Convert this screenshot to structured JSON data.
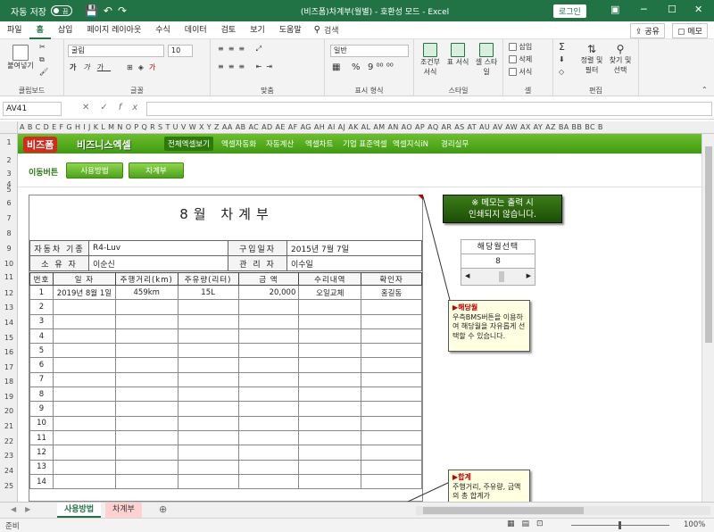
{
  "titlebar": {
    "autosave_label": "자동 저장",
    "autosave_state": "끔",
    "window_title": "(비즈폼)차계부(월별) - 호환성 모드 - Excel",
    "login_label": "로그인"
  },
  "menu": {
    "tabs": [
      "파일",
      "홈",
      "삽입",
      "페이지 레이아웃",
      "수식",
      "데이터",
      "검토",
      "보기",
      "도움말"
    ],
    "active_tab": "홈",
    "search_label": "검색",
    "share_label": "공유",
    "memo_label": "메모"
  },
  "ribbon": {
    "paste_label": "붙여넣기",
    "font_name": "굴림",
    "font_size": "10",
    "number_format": "일반",
    "percent_symbol": "%",
    "conditional_label": "조건부 서식",
    "table_label": "표 서식",
    "cellstyle_label": "셀 스타일",
    "insert_label": "삽입",
    "delete_label": "삭제",
    "format_label": "서식",
    "sort_label": "정렬 및 필터",
    "find_label": "찾기 및 선택",
    "groups": [
      "클립보드",
      "글꼴",
      "맞춤",
      "표시 형식",
      "스타일",
      "셀",
      "편집"
    ]
  },
  "formula_bar": {
    "name_box": "AV41",
    "fx": "fx",
    "content": ""
  },
  "column_letters": "A B C D E F G H I J K L M N O P Q R S T U V W X Y Z AA AB AC AD AE AF AG AH AI AJ AK AL AM AN AO AP AQ AR AS AT AU AV AW AX AY AZ BA BB BC B",
  "row_numbers": [
    "1",
    "2",
    "3",
    "4",
    "5",
    "6",
    "7",
    "8",
    "9",
    "10",
    "11",
    "12",
    "13",
    "14",
    "15",
    "16",
    "17",
    "18",
    "19",
    "20",
    "21",
    "22",
    "23",
    "24",
    "25"
  ],
  "navbar": {
    "brand": "비즈폼",
    "brand2": "비즈니스엑셀",
    "items": [
      "전체엑셀보기",
      "엑셀자동화",
      "자동계산",
      "엑셀차트",
      "기업 표준엑셀",
      "엑셀지식iN",
      "경리실무"
    ],
    "active_item": "전체엑셀보기"
  },
  "movebar": {
    "label": "이동버튼",
    "buttons": [
      "사용방법",
      "차계부"
    ]
  },
  "report": {
    "title": "8월  차계부",
    "car_label": "자동차 기종",
    "car_value": "R4-Luv",
    "buy_label": "구입일자",
    "buy_value": "2015년  7월  7일",
    "owner_label": "소 유 자",
    "owner_value": "이순신",
    "manager_label": "관 리 자",
    "manager_value": "이수일",
    "columns": [
      "번호",
      "일 자",
      "주행거리(km)",
      "주유량(리터)",
      "금 액",
      "수리내역",
      "확인자"
    ],
    "rows": [
      [
        "1",
        "2019년 8월 1일",
        "459km",
        "15L",
        "20,000",
        "오일교체",
        "홍길동"
      ],
      [
        "2",
        "",
        "",
        "",
        "",
        "",
        ""
      ],
      [
        "3",
        "",
        "",
        "",
        "",
        "",
        ""
      ],
      [
        "4",
        "",
        "",
        "",
        "",
        "",
        ""
      ],
      [
        "5",
        "",
        "",
        "",
        "",
        "",
        ""
      ],
      [
        "6",
        "",
        "",
        "",
        "",
        "",
        ""
      ],
      [
        "7",
        "",
        "",
        "",
        "",
        "",
        ""
      ],
      [
        "8",
        "",
        "",
        "",
        "",
        "",
        ""
      ],
      [
        "9",
        "",
        "",
        "",
        "",
        "",
        ""
      ],
      [
        "10",
        "",
        "",
        "",
        "",
        "",
        ""
      ],
      [
        "11",
        "",
        "",
        "",
        "",
        "",
        ""
      ],
      [
        "12",
        "",
        "",
        "",
        "",
        "",
        ""
      ],
      [
        "13",
        "",
        "",
        "",
        "",
        "",
        ""
      ],
      [
        "14",
        "",
        "",
        "",
        "",
        "",
        ""
      ]
    ]
  },
  "notice": {
    "line1": "※ 메모는 출력 시",
    "line2": "인쇄되지 않습니다."
  },
  "month_box": {
    "caption": "해당월선택",
    "value": "8"
  },
  "comment1": {
    "heading": "▶해당월",
    "body": "우측BMS버튼을 이용하여 해당월을 자유롭게 선택할 수 있습니다."
  },
  "comment2": {
    "heading": "▶합계",
    "body": "주행거리, 주유량, 금액의 총 합계가"
  },
  "sheet_tabs": [
    "사용방법",
    "차계부"
  ],
  "status": {
    "ready": "준비",
    "zoom": "100%"
  },
  "colors": {
    "excel_green": "#217346",
    "nav_green": "#4ea11c",
    "brand_red": "#d9281c",
    "comment_bg": "#ffffe1",
    "comment_head": "#c00000"
  }
}
